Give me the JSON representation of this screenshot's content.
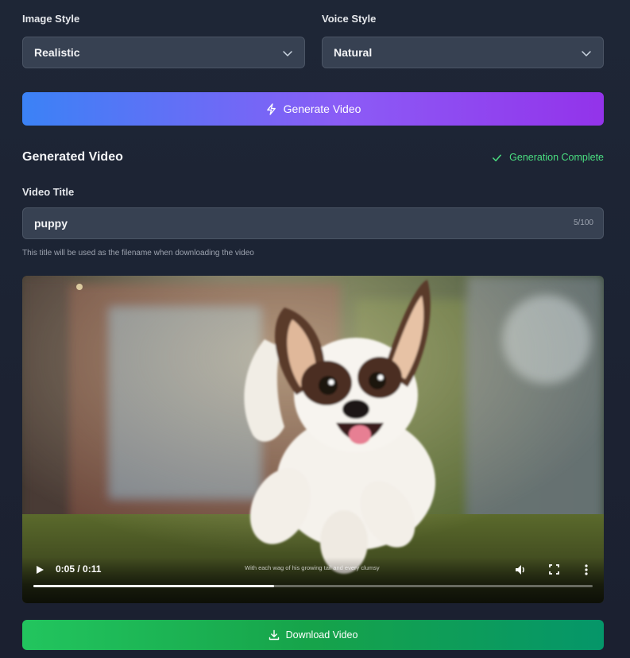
{
  "image_style": {
    "label": "Image Style",
    "value": "Realistic"
  },
  "voice_style": {
    "label": "Voice Style",
    "value": "Natural"
  },
  "generate_button": {
    "label": "Generate Video"
  },
  "output": {
    "title": "Generated Video",
    "status": "Generation Complete"
  },
  "video_title": {
    "label": "Video Title",
    "value": "puppy",
    "counter": "5/100",
    "hint": "This title will be used as the filename when downloading the video"
  },
  "player": {
    "time": "0:05 / 0:11",
    "subtitle": "With each wag of his growing tail and every clumsy",
    "progress": 0.43
  },
  "download_button": {
    "label": "Download Video"
  },
  "colors": {
    "accent_blue": "#3b82f6",
    "accent_purple": "#9333ea",
    "success_green": "#4ade80",
    "download_green": "#22c55e"
  }
}
